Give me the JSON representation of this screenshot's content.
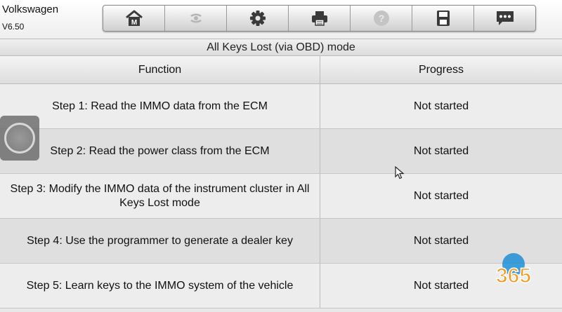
{
  "brand": {
    "name": "Volkswagen",
    "version": "V6.50"
  },
  "toolbar": {
    "buttons": [
      {
        "icon": "home-icon",
        "enabled": true
      },
      {
        "icon": "vehicle-swap-icon",
        "enabled": false
      },
      {
        "icon": "gear-icon",
        "enabled": true
      },
      {
        "icon": "printer-icon",
        "enabled": true
      },
      {
        "icon": "help-icon",
        "enabled": false
      },
      {
        "icon": "save-icon",
        "enabled": true
      },
      {
        "icon": "message-icon",
        "enabled": true
      }
    ]
  },
  "mode_title": "All Keys Lost (via OBD) mode",
  "table": {
    "headers": [
      "Function",
      "Progress"
    ],
    "rows": [
      {
        "function": "Step 1: Read the IMMO data from the ECM",
        "progress": "Not started"
      },
      {
        "function": "Step 2: Read the power class from the ECM",
        "progress": "Not started"
      },
      {
        "function": "Step 3: Modify the IMMO data of the instrument cluster in All Keys Lost mode",
        "progress": "Not started"
      },
      {
        "function": "Step 4: Use the programmer to generate a dealer key",
        "progress": "Not started"
      },
      {
        "function": "Step 5: Learn keys to the IMMO system of the vehicle",
        "progress": "Not started"
      }
    ]
  },
  "watermark": {
    "text": "365"
  },
  "colors": {
    "toolbar_icon": "#3a3a3a",
    "disabled_icon": "#b5b5b5",
    "watermark_orange": "#f39a1e"
  }
}
